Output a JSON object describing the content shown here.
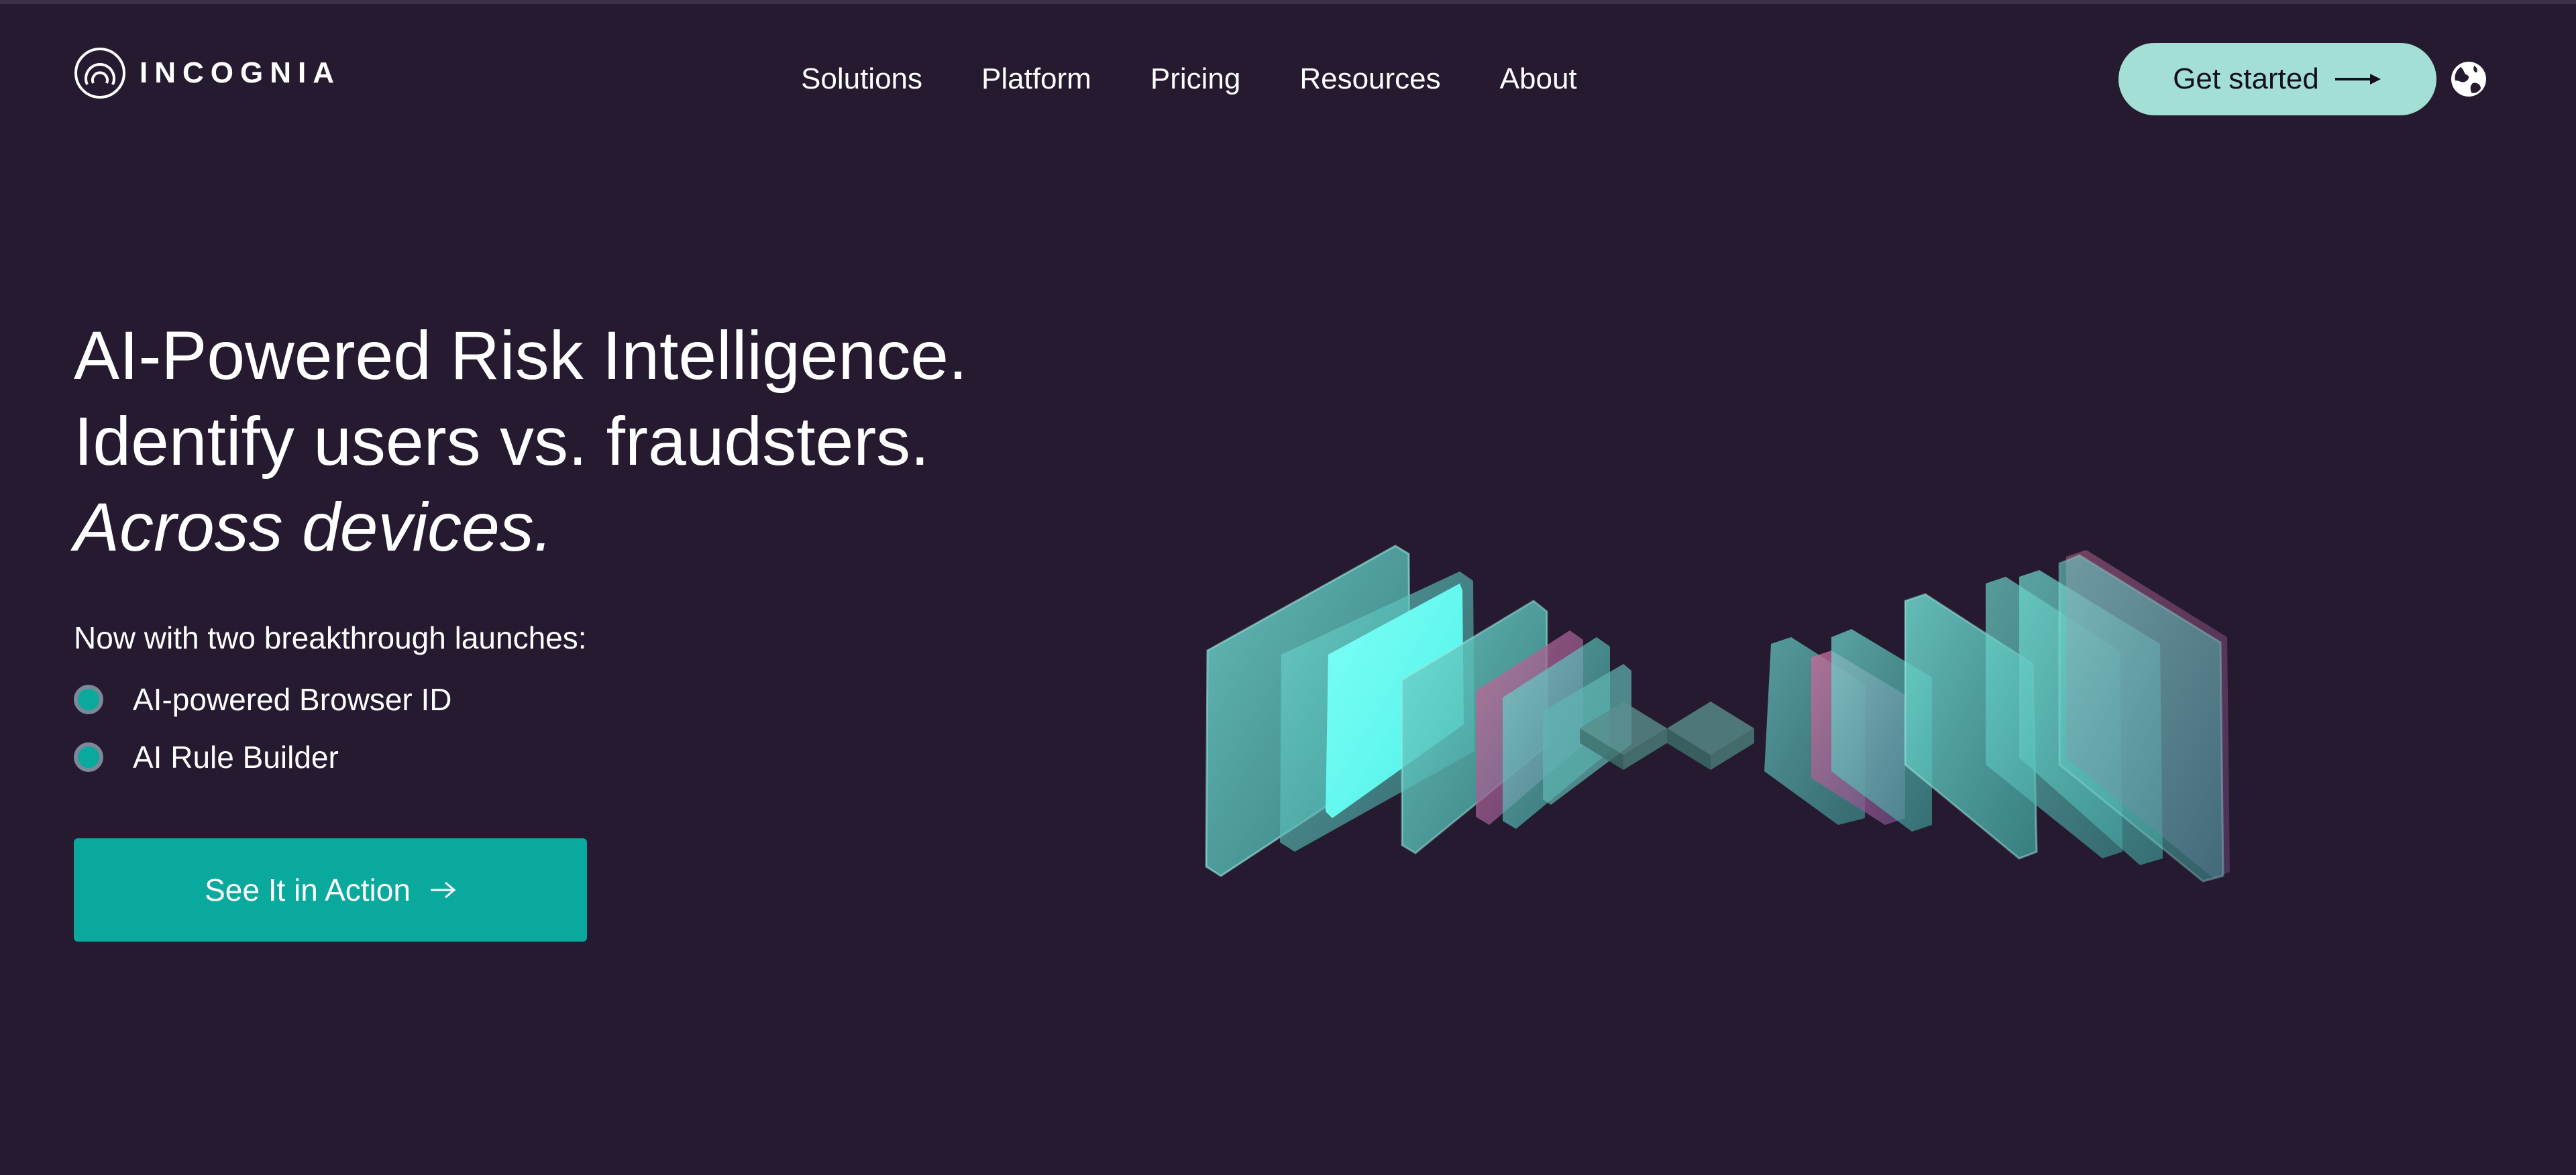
{
  "header": {
    "logo_text": "INCOGNIA",
    "nav": [
      {
        "label": "Solutions"
      },
      {
        "label": "Platform"
      },
      {
        "label": "Pricing"
      },
      {
        "label": "Resources"
      },
      {
        "label": "About"
      }
    ],
    "cta_label": "Get started",
    "cta_icon": "arrow-right-long-icon",
    "language_icon": "globe-icon"
  },
  "hero": {
    "lines": [
      "AI-Powered Risk Intelligence.",
      "Identify users vs. fraudsters.",
      "Across devices."
    ],
    "launch_intro": "Now with two breakthrough launches:",
    "launches": [
      {
        "label": "AI-powered Browser ID"
      },
      {
        "label": "AI Rule Builder"
      }
    ],
    "cta_label": "See It in Action",
    "cta_icon": "arrow-right-icon"
  },
  "illustration": {
    "icon": "glass-panels-illustration"
  },
  "colors": {
    "background": "#251a2f",
    "accent": "#0aa99e",
    "cta_light": "#a4dfd5",
    "panel_teal": "#5cc7bf",
    "panel_glow": "#6af7f0",
    "panel_pink": "#b65c8a"
  }
}
